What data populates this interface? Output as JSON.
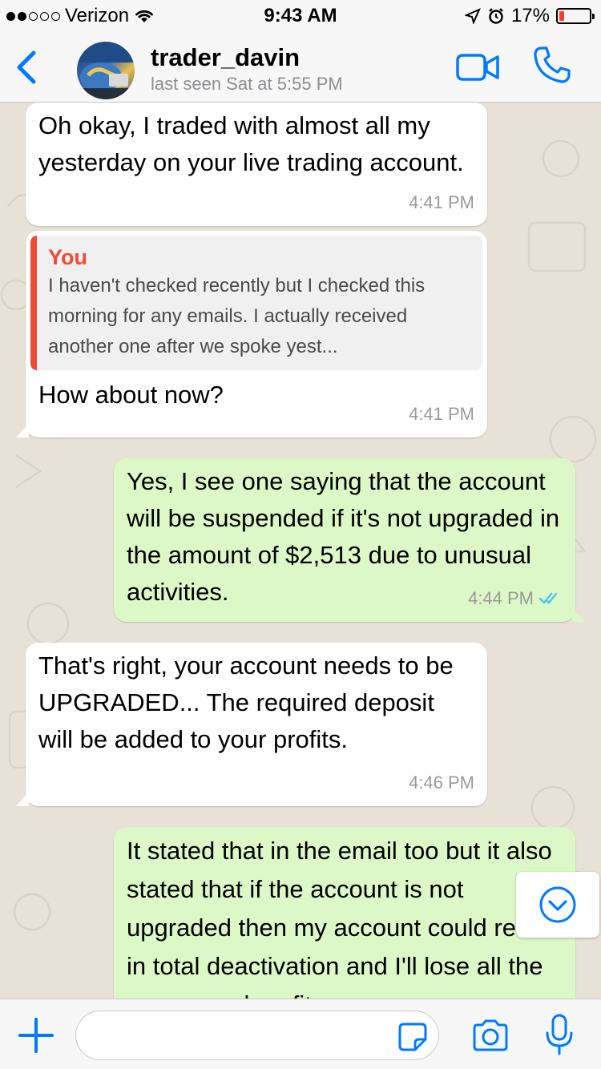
{
  "status_bar": {
    "carrier": "Verizon",
    "time": "9:43 AM",
    "battery": "17%",
    "battery_level": 0.17,
    "signal_dots_filled": 2,
    "signal_dots_total": 5
  },
  "header": {
    "back_icon": "chevron-left-icon",
    "contact_name": "trader_davin",
    "last_seen": "last seen Sat at 5:55 PM",
    "video_icon": "video-camera-icon",
    "call_icon": "phone-icon"
  },
  "messages": [
    {
      "direction": "incoming",
      "text": "Oh okay, I traded with almost all my yesterday on your live trading account.",
      "time": "4:41 PM"
    },
    {
      "direction": "incoming",
      "quote": {
        "author": "You",
        "text": "I haven't checked recently but I checked this morning for any emails. I actually received another one after we spoke yest..."
      },
      "text": "How about now?",
      "time": "4:41 PM"
    },
    {
      "direction": "outgoing",
      "text": "Yes, I see one saying that the account will be suspended if it's not upgraded in the amount of $2,513 due to unusual activities.",
      "time": "4:44 PM",
      "status": "read"
    },
    {
      "direction": "incoming",
      "text": "That's right, your account needs to be UPGRADED... The required deposit will be added to your profits.",
      "time": "4:46 PM"
    },
    {
      "direction": "outgoing",
      "text": "It stated that in the email too but it also stated that if the account is not upgraded then my account could result in total deactivation and I'll lose all the money and profits",
      "time": ""
    }
  ],
  "input": {
    "placeholder": "",
    "value": ""
  },
  "colors": {
    "accent": "#007aff",
    "incoming_bubble": "#ffffff",
    "outgoing_bubble": "#dcf8c6",
    "quote_accent": "#f04a3a",
    "read_ticks": "#4fc3f7",
    "battery_low": "#ff3b30"
  }
}
